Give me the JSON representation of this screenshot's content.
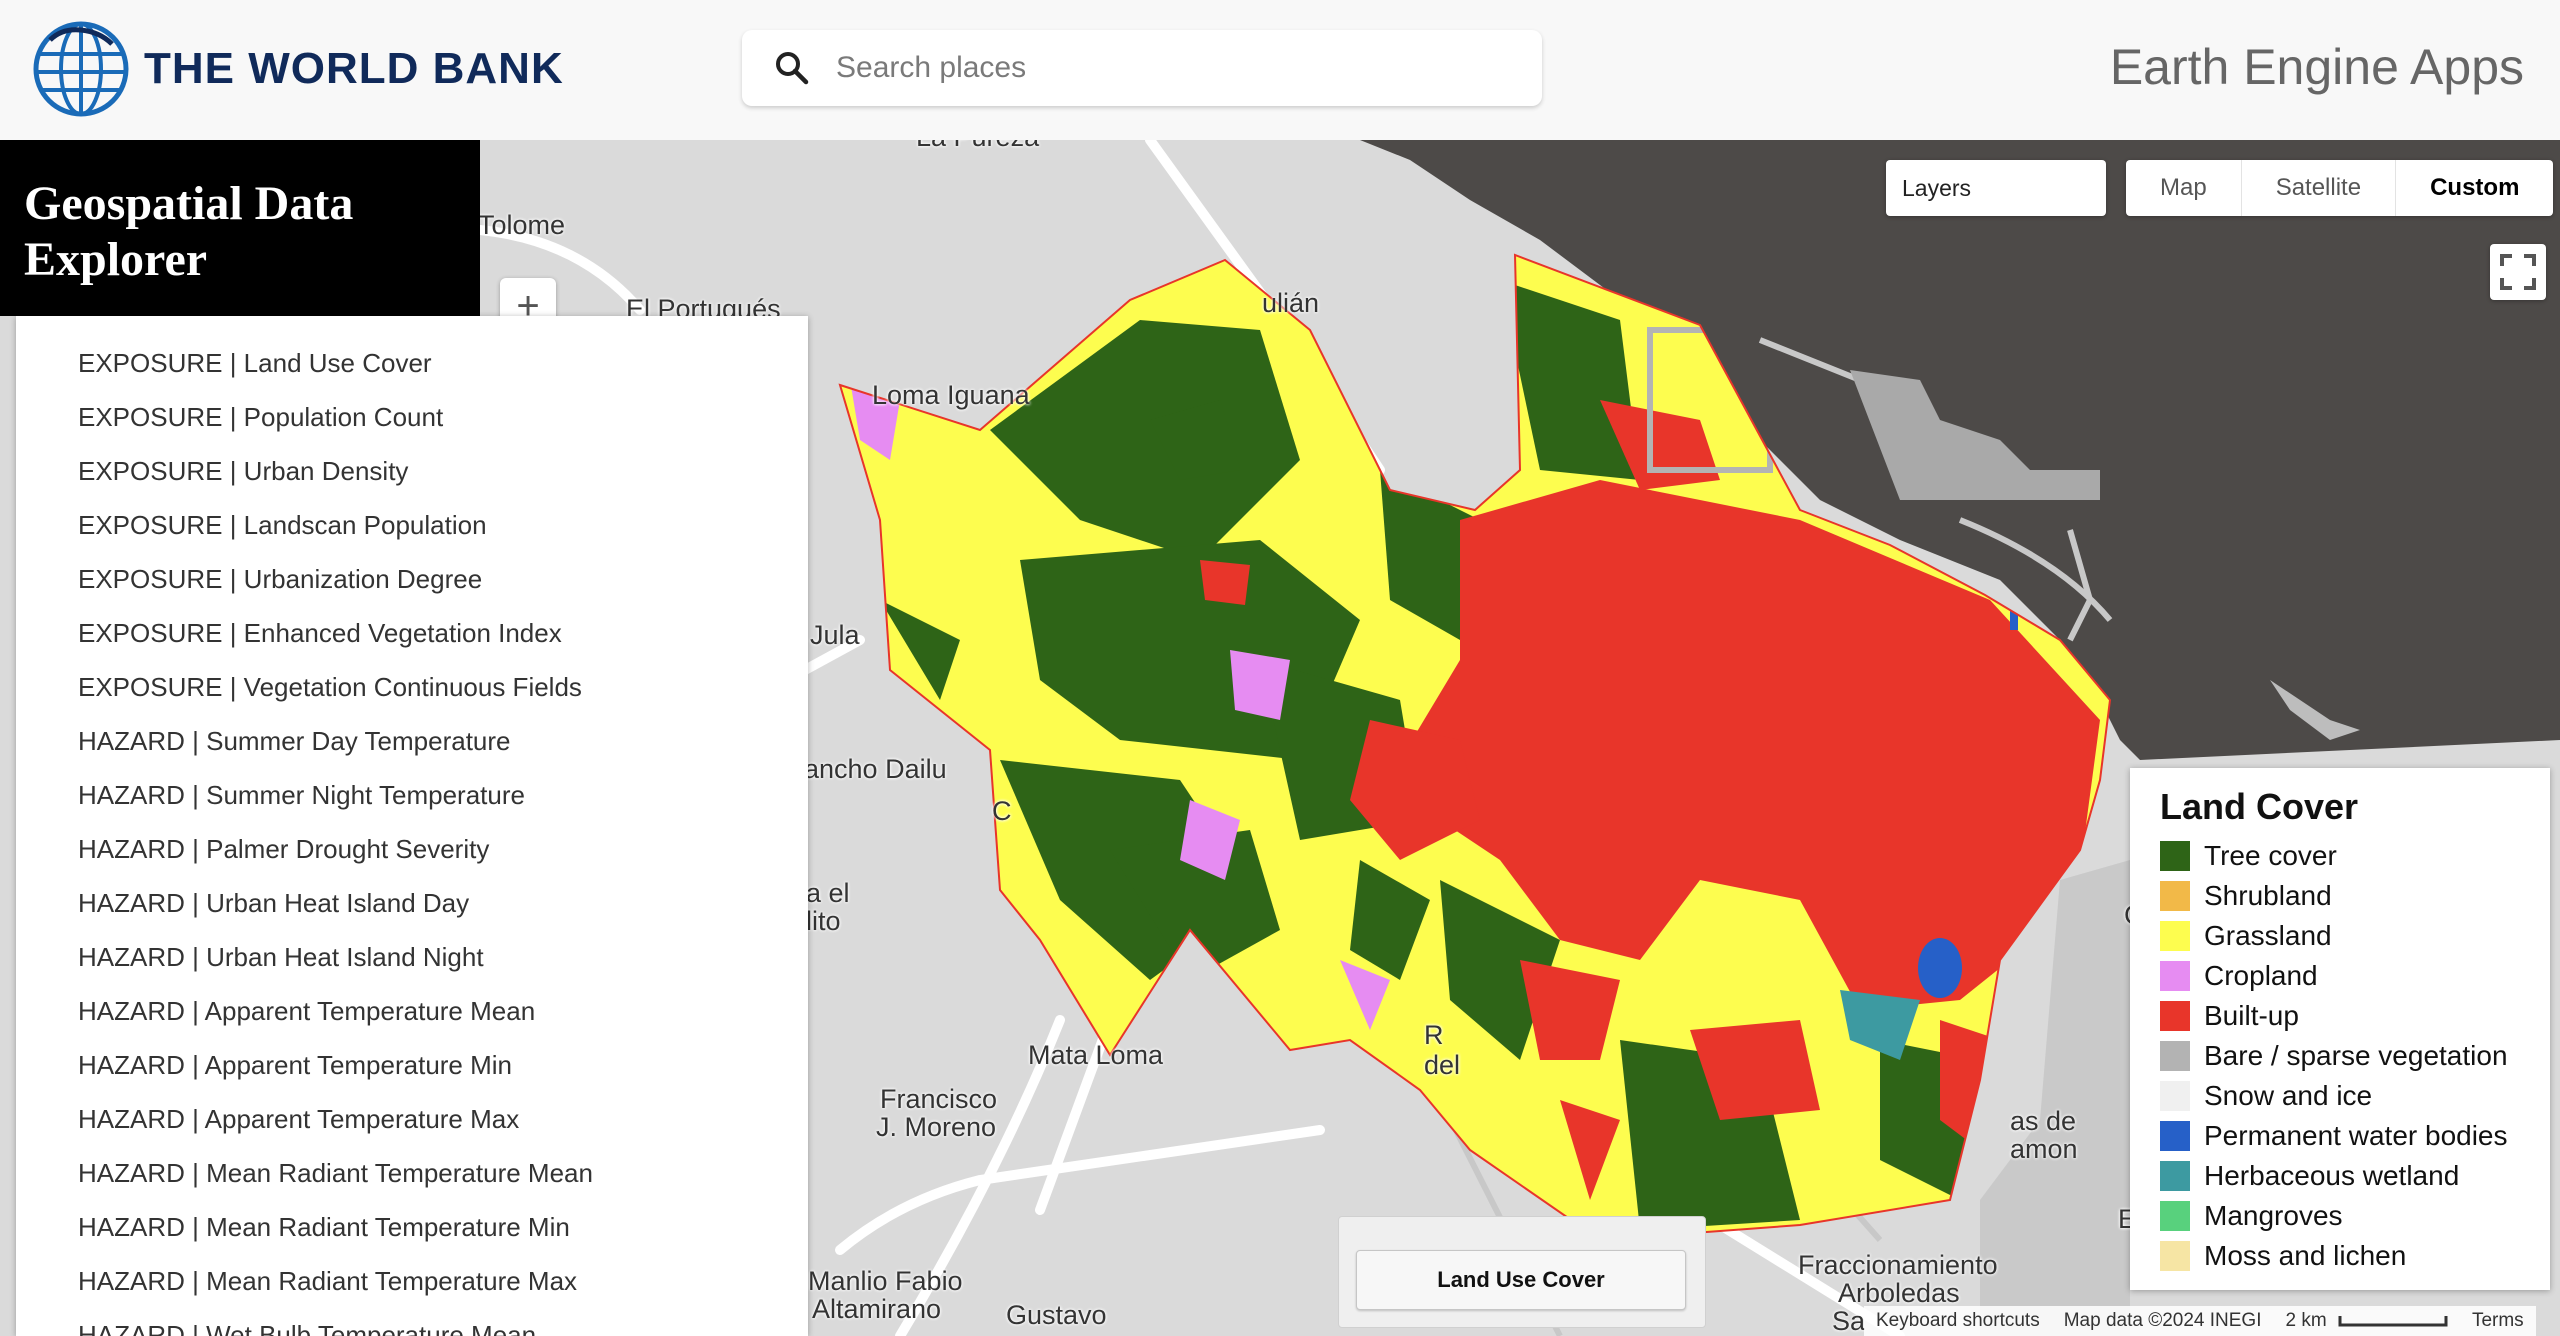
{
  "header": {
    "org": "THE WORLD BANK",
    "search_placeholder": "Search places",
    "app_title": "Earth Engine Apps"
  },
  "panel": {
    "title_line1": "Geospatial Data",
    "title_line2": "Explorer",
    "zoom_in": "+",
    "layers": [
      "EXPOSURE | Land Use Cover",
      "EXPOSURE | Population Count",
      "EXPOSURE | Urban Density",
      "EXPOSURE | Landscan Population",
      "EXPOSURE | Urbanization Degree",
      "EXPOSURE | Enhanced Vegetation Index",
      "EXPOSURE | Vegetation Continuous Fields",
      "HAZARD | Summer Day Temperature",
      "HAZARD | Summer Night Temperature",
      "HAZARD | Palmer Drought Severity",
      "HAZARD | Urban Heat Island Day",
      "HAZARD | Urban Heat Island Night",
      "HAZARD | Apparent Temperature Mean",
      "HAZARD | Apparent Temperature Min",
      "HAZARD | Apparent Temperature Max",
      "HAZARD | Mean Radiant Temperature Mean",
      "HAZARD | Mean Radiant Temperature Min",
      "HAZARD | Mean Radiant Temperature Max",
      "HAZARD | Wet Bulb Temperature Mean"
    ]
  },
  "map_controls": {
    "layers_label": "Layers",
    "map_types": [
      "Map",
      "Satellite",
      "Custom"
    ],
    "active_map_type": "Custom"
  },
  "places": {
    "la_pureza": "La Pureza",
    "tolome": "Tolome",
    "el_portugues": "El Portugués",
    "julian": "ulián",
    "loma_iguana": "Loma Iguana",
    "jula": "Jula",
    "rancho_dailu": "ancho Dailu",
    "c": "C",
    "a_el": "a el",
    "lito": "lito",
    "mata_loma": "Mata Loma",
    "francisco": "Francisco",
    "j_moreno": "J. Moreno",
    "r": "R",
    "del": "del",
    "as_de": "as de",
    "amon": "amon",
    "manlio": "Manlio Fabio",
    "altamirano": "Altamirano",
    "gustavo": "Gustavo",
    "fraccionamiento": "Fraccionamiento",
    "arboledas": "Arboledas",
    "sa": "Sa",
    "e": "E",
    "right_c": "C"
  },
  "legend": {
    "title": "Land Cover",
    "items": [
      {
        "label": "Tree cover",
        "color": "#2e6417"
      },
      {
        "label": "Shrubland",
        "color": "#f2b948"
      },
      {
        "label": "Grassland",
        "color": "#fdfd4f"
      },
      {
        "label": "Cropland",
        "color": "#e68cf2"
      },
      {
        "label": "Built-up",
        "color": "#e8352a"
      },
      {
        "label": "Bare / sparse vegetation",
        "color": "#b3b3b3"
      },
      {
        "label": "Snow and ice",
        "color": "#f0f0f0"
      },
      {
        "label": "Permanent water bodies",
        "color": "#2660c8"
      },
      {
        "label": "Herbaceous wetland",
        "color": "#3d9aa1"
      },
      {
        "label": "Mangroves",
        "color": "#58d17d"
      },
      {
        "label": "Moss and lichen",
        "color": "#f6e5a4"
      }
    ]
  },
  "bottom": {
    "land_use_button": "Land Use Cover",
    "keyboard_shortcuts": "Keyboard shortcuts",
    "map_data": "Map data ©2024 INEGI",
    "scale": "2 km",
    "terms": "Terms"
  }
}
